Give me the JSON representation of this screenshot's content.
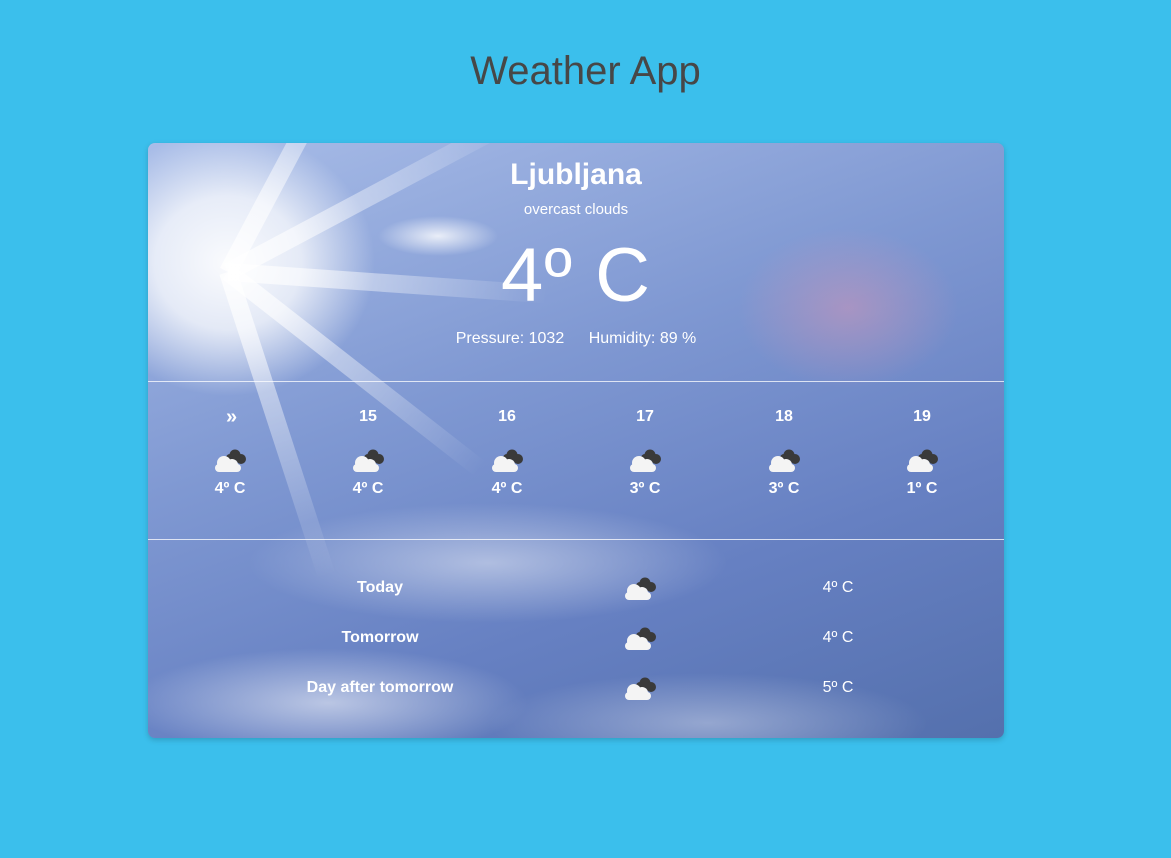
{
  "app": {
    "title": "Weather App"
  },
  "current": {
    "city": "Ljubljana",
    "description": "overcast clouds",
    "temperature": "4º C",
    "pressure": "Pressure: 1032",
    "humidity": "Humidity: 89 %",
    "icon": "overcast-clouds-icon"
  },
  "hourly": [
    {
      "label": "»",
      "temp": "4º C",
      "icon": "overcast-clouds-icon"
    },
    {
      "label": "15",
      "temp": "4º C",
      "icon": "overcast-clouds-icon"
    },
    {
      "label": "16",
      "temp": "4º C",
      "icon": "overcast-clouds-icon"
    },
    {
      "label": "17",
      "temp": "3º C",
      "icon": "overcast-clouds-icon"
    },
    {
      "label": "18",
      "temp": "3º C",
      "icon": "overcast-clouds-icon"
    },
    {
      "label": "19",
      "temp": "1º C",
      "icon": "overcast-clouds-icon"
    }
  ],
  "daily": [
    {
      "day": "Today",
      "temp": "4º C",
      "icon": "overcast-clouds-icon"
    },
    {
      "day": "Tomorrow",
      "temp": "4º C",
      "icon": "overcast-clouds-icon"
    },
    {
      "day": "Day after tomorrow",
      "temp": "5º C",
      "icon": "overcast-clouds-icon"
    }
  ],
  "colors": {
    "page_background": "#3bbfec",
    "title_text": "#474747",
    "card_text": "#ffffff"
  }
}
